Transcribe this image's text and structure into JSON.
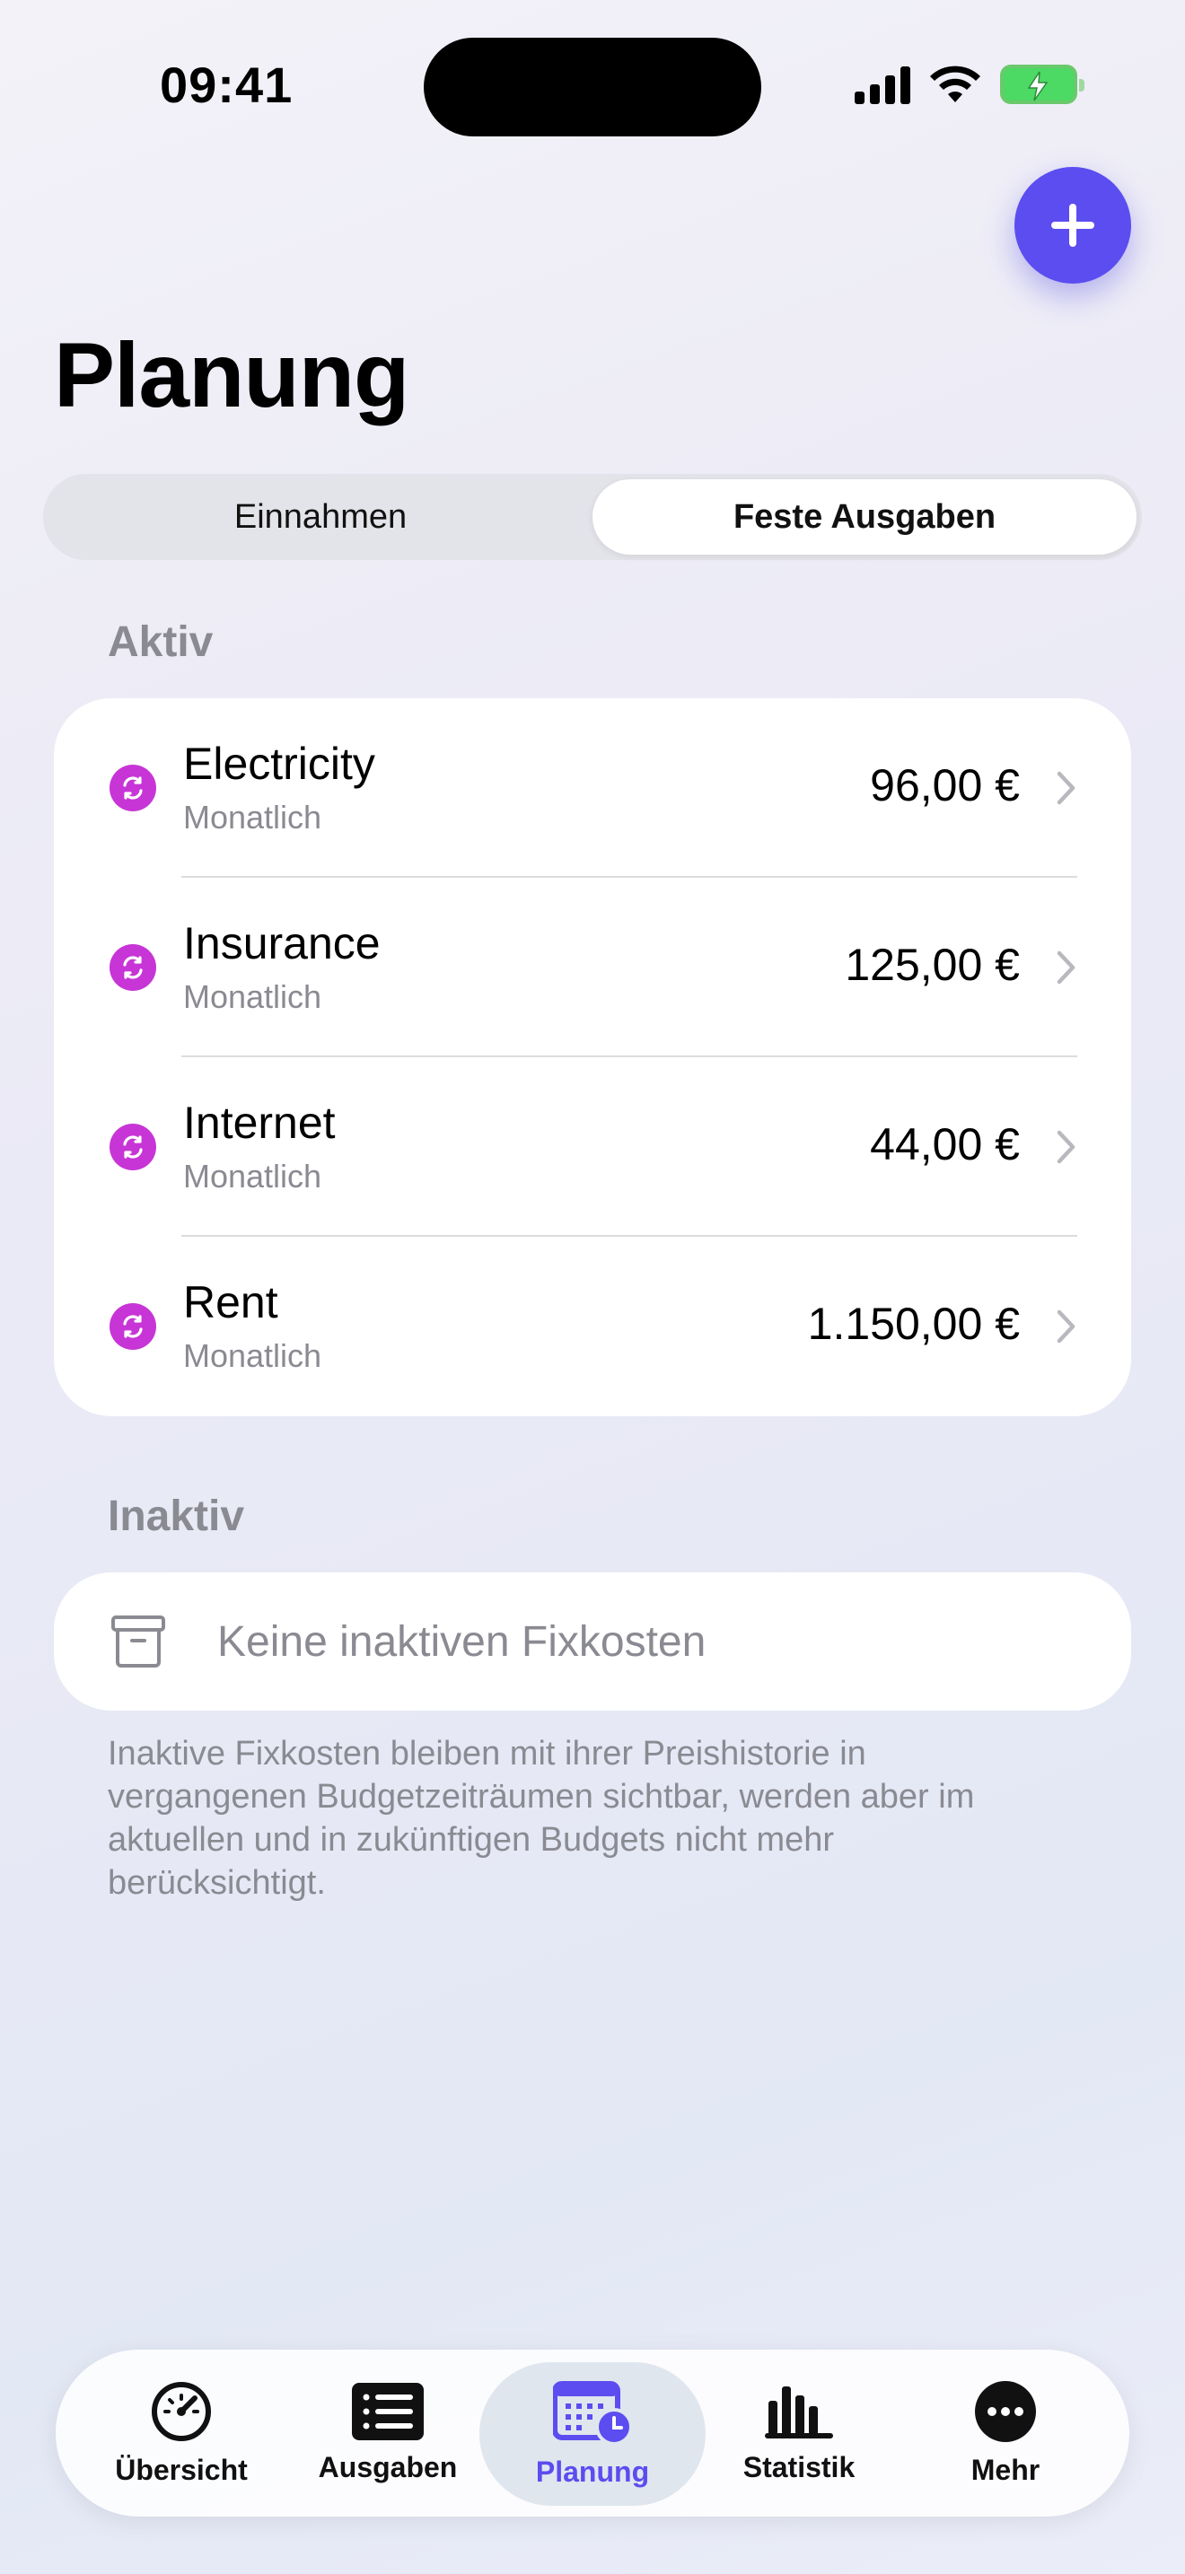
{
  "status_bar": {
    "time": "09:41"
  },
  "header": {
    "title": "Planung",
    "add_icon": "plus-icon"
  },
  "segmented": {
    "income": "Einnahmen",
    "fixed_expenses": "Feste Ausgaben",
    "selected": "Feste Ausgaben"
  },
  "active_section": {
    "label": "Aktiv",
    "items": [
      {
        "name": "Electricity",
        "frequency": "Monatlich",
        "amount": "96,00 €"
      },
      {
        "name": "Insurance",
        "frequency": "Monatlich",
        "amount": "125,00 €"
      },
      {
        "name": "Internet",
        "frequency": "Monatlich",
        "amount": "44,00 €"
      },
      {
        "name": "Rent",
        "frequency": "Monatlich",
        "amount": "1.150,00 €"
      }
    ]
  },
  "inactive_section": {
    "label": "Inaktiv",
    "empty_text": "Keine inaktiven Fixkosten",
    "footnote": "Inaktive Fixkosten bleiben mit ihrer Preishistorie in vergangenen Budgetzeiträumen sichtbar, werden aber im aktuellen und in zukünftigen Budgets nicht mehr berücksichtigt."
  },
  "tab_bar": {
    "tabs": [
      {
        "label": "Übersicht",
        "icon": "speedometer-icon"
      },
      {
        "label": "Ausgaben",
        "icon": "list-icon"
      },
      {
        "label": "Planung",
        "icon": "calendar-clock-icon",
        "active": true
      },
      {
        "label": "Statistik",
        "icon": "bar-chart-icon"
      },
      {
        "label": "Mehr",
        "icon": "more-icon"
      }
    ]
  },
  "colors": {
    "accent": "#5b4df0",
    "recurring_icon": "#c735d6",
    "battery": "#4cd964"
  }
}
